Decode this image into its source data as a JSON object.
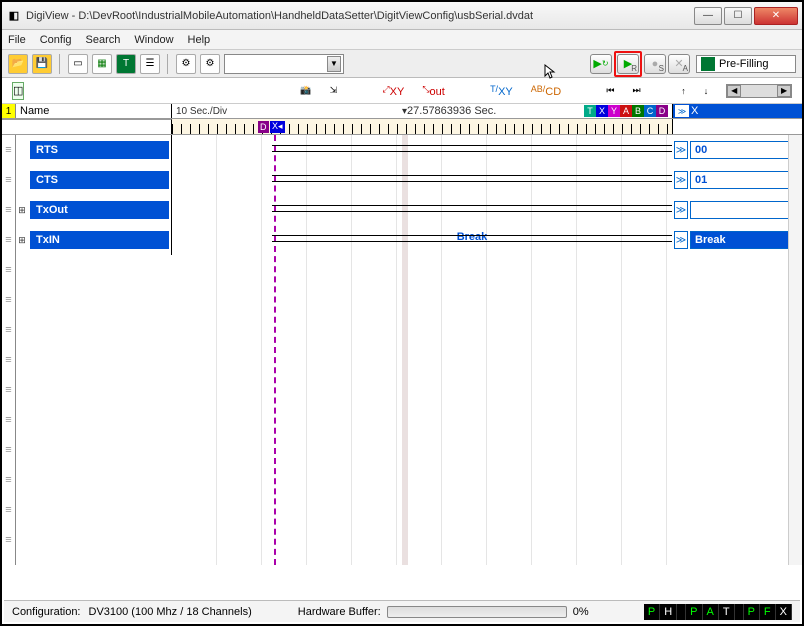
{
  "window": {
    "title": "DigiView - D:\\DevRoot\\IndustrialMobileAutomation\\HandheldDataSetter\\DigitViewConfig\\usbSerial.dvdat"
  },
  "menu": [
    "File",
    "Config",
    "Search",
    "Window",
    "Help"
  ],
  "capture": {
    "status": "Pre-Filling",
    "run_sub": "R",
    "s_sub": "S",
    "a_sub": "A"
  },
  "timebase": {
    "scale": "10 Sec./Div",
    "trigger_time": "27.57863936 Sec.",
    "name_header": "Name",
    "index": "1"
  },
  "markers": [
    "T",
    "X",
    "Y",
    "A",
    "B",
    "C",
    "D"
  ],
  "marker_colors": [
    "#0a8",
    "#00d",
    "#c0c",
    "#c11",
    "#070",
    "#06c",
    "#808"
  ],
  "signals": [
    {
      "name": "RTS",
      "value": "00",
      "expand": false,
      "break": false,
      "blue": false
    },
    {
      "name": "CTS",
      "value": "01",
      "expand": false,
      "break": false,
      "blue": false
    },
    {
      "name": "TxOut",
      "value": "",
      "expand": true,
      "break": false,
      "blue": false
    },
    {
      "name": "TxIN",
      "value": "Break",
      "expand": true,
      "break": true,
      "blue": true
    }
  ],
  "break_label": "Break",
  "statusbar": {
    "config_label": "Configuration:",
    "config_value": "DV3100 (100 Mhz / 18 Channels)",
    "buffer_label": "Hardware Buffer:",
    "buffer_pct": "0%",
    "flags": [
      "P",
      "H",
      " ",
      "P",
      "A",
      "T",
      " ",
      "P",
      "F",
      "X"
    ]
  },
  "bluebar_x": "X"
}
